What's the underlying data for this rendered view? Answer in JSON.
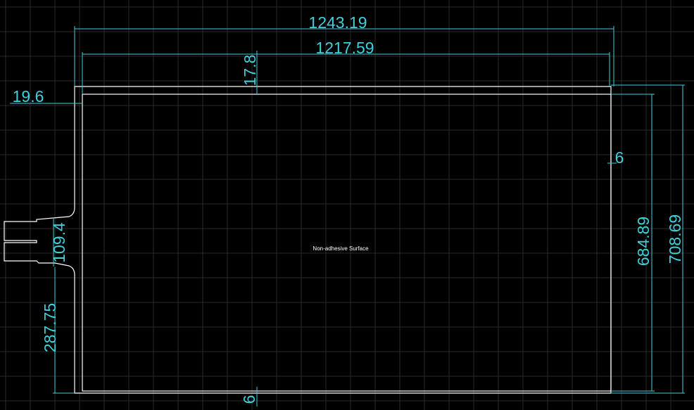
{
  "drawing": {
    "background_color": "#000000",
    "outline_color": "#ffffff",
    "dimension_color": "#3fd0dc",
    "grid_color": "#2a2a2a",
    "label": "Non-adhesive Surface"
  },
  "dimensions": {
    "overall_width": "1243.19",
    "inner_width": "1217.59",
    "top_margin": "17.8",
    "left_margin": "19.6",
    "right_gap": "6",
    "tail_width": "109.4",
    "tail_offset": "287.75",
    "inner_height": "684.89",
    "overall_height": "708.69",
    "bottom_gap": "6"
  }
}
